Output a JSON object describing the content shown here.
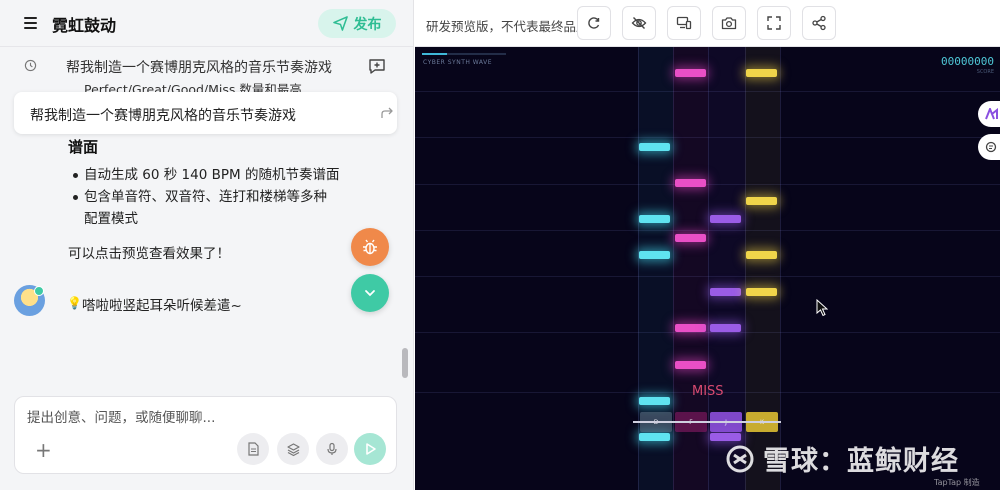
{
  "app": {
    "title": "霓虹鼓动",
    "publish_label": "发布"
  },
  "chat": {
    "session_title": "帮我制造一个赛博朋克风格的音乐节奏游戏",
    "truncated_line": "Perfect/Great/Good/Miss 数量和最高",
    "prompt_card": "帮我制造一个赛博朋克风格的音乐节奏游戏",
    "section_heading": "谱面",
    "bullets": [
      "自动生成 60 秒 140 BPM 的随机节奏谱面",
      "包含单音符、双音符、连打和楼梯等多种配置模式"
    ],
    "preview_line": "可以点击预览查看效果了！",
    "thinking": "嗒啦啦竖起耳朵听候差遣~",
    "input_placeholder": "提出创意、问题，或随便聊聊..."
  },
  "preview": {
    "label": "研发预览版，不代表最终品质",
    "toolbar_icons": [
      "refresh-icon",
      "eye-off-icon",
      "devices-icon",
      "camera-icon",
      "fullscreen-icon",
      "share-icon"
    ]
  },
  "game": {
    "title": "CYBER SYNTH WAVE",
    "score": "00000000",
    "score_label": "SCORE",
    "judgement": "MISS",
    "progress": 0.3,
    "keys": [
      "D",
      "F",
      "J",
      "K"
    ],
    "colors": {
      "cyan": "#5fe3f0",
      "pink": "#e94fc6",
      "purple": "#9a5ce6",
      "yellow": "#f0d54a",
      "accent": "#3fcaa5"
    }
  },
  "watermark": {
    "text": "雪球：蓝鲸财经",
    "small": "TapTap 制造"
  }
}
